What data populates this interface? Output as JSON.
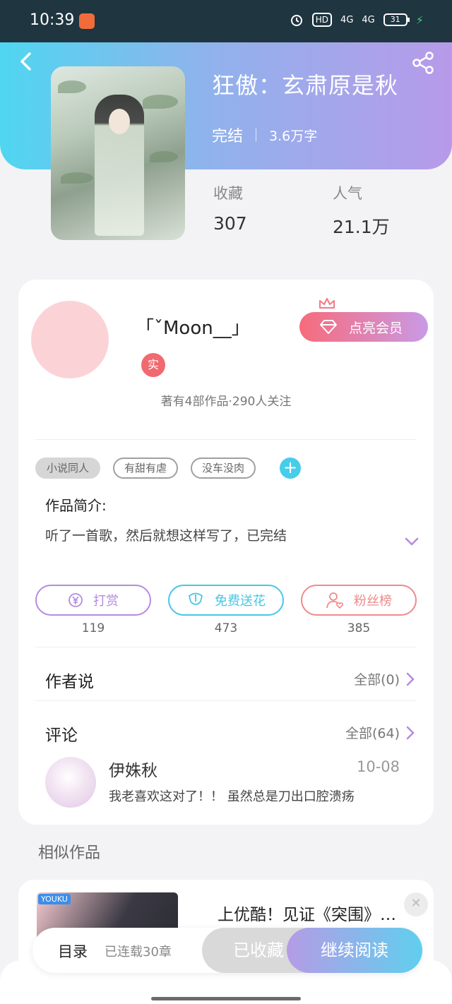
{
  "status_bar": {
    "time": "10:39",
    "network_1": "4G",
    "network_2": "4G",
    "battery": "31",
    "hd_label": "HD"
  },
  "book": {
    "title": "狂傲：玄肃原是秋",
    "status": "完结",
    "words": "3.6万字",
    "favorites_label": "收藏",
    "favorites_value": "307",
    "popularity_label": "人气",
    "popularity_value": "21.1万"
  },
  "author": {
    "name": "「ˇMoon__」",
    "verified_badge": "实",
    "vip_button": "点亮会员",
    "works_info": "著有4部作品·290人关注"
  },
  "tags": [
    "小说同人",
    "有甜有虐",
    "没车没肉"
  ],
  "intro": {
    "title": "作品简介:",
    "text": "听了一首歌，然后就想这样写了，已完结"
  },
  "actions": [
    {
      "label": "打赏",
      "count": "119",
      "color": "#b48be0"
    },
    {
      "label": "免费送花",
      "count": "473",
      "color": "#47c7e4"
    },
    {
      "label": "粉丝榜",
      "count": "385",
      "color": "#ef8a8a"
    }
  ],
  "author_says": {
    "title": "作者说",
    "link": "全部(0)"
  },
  "comments": {
    "title": "评论",
    "link": "全部(64)",
    "items": [
      {
        "user": "伊姝秋",
        "date": "10-08",
        "text": "我老喜欢这对了！！ 虽然总是刀出口腔溃疡"
      }
    ]
  },
  "similar": {
    "title": "相似作品",
    "ad_logo": "YOUKU",
    "ad_text": "上优酷！见证《突围》…"
  },
  "bottom_bar": {
    "toc": "目录",
    "serial_info": "已连载30章",
    "favorited": "已收藏",
    "continue": "继续阅读"
  },
  "colors": {
    "hero_start": "#4fd6f1",
    "hero_end": "#b79ae9",
    "accent_cyan": "#46cdea",
    "vip_pink": "#f76b7b"
  }
}
